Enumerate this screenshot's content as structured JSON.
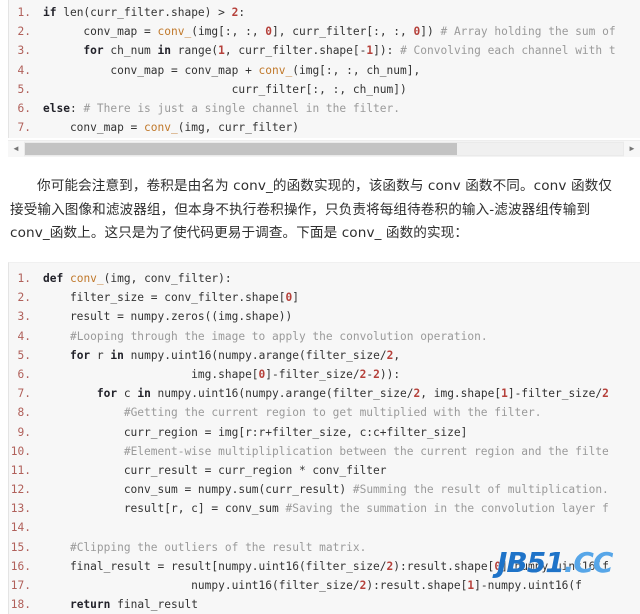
{
  "code_block_one": {
    "language": "python",
    "lines": [
      {
        "num": "1.",
        "tokens": [
          {
            "t": "if",
            "c": "kw"
          },
          {
            "t": " len(curr_filter.shape) > ",
            "c": "pl"
          },
          {
            "t": "2",
            "c": "num"
          },
          {
            "t": ":",
            "c": "pl"
          }
        ]
      },
      {
        "num": "2.",
        "tokens": [
          {
            "t": "      conv_map = ",
            "c": "pl"
          },
          {
            "t": "conv_",
            "c": "fn"
          },
          {
            "t": "(img[:, :, ",
            "c": "pl"
          },
          {
            "t": "0",
            "c": "num"
          },
          {
            "t": "], curr_filter[:, :, ",
            "c": "pl"
          },
          {
            "t": "0",
            "c": "num"
          },
          {
            "t": "]) ",
            "c": "pl"
          },
          {
            "t": "# Array holding the sum of",
            "c": "cm"
          }
        ]
      },
      {
        "num": "3.",
        "tokens": [
          {
            "t": "      ",
            "c": "pl"
          },
          {
            "t": "for",
            "c": "kw"
          },
          {
            "t": " ch_num ",
            "c": "pl"
          },
          {
            "t": "in",
            "c": "kw"
          },
          {
            "t": " range(",
            "c": "pl"
          },
          {
            "t": "1",
            "c": "num"
          },
          {
            "t": ", curr_filter.shape[-",
            "c": "pl"
          },
          {
            "t": "1",
            "c": "num"
          },
          {
            "t": "]): ",
            "c": "pl"
          },
          {
            "t": "# Convolving each channel with t",
            "c": "cm"
          }
        ]
      },
      {
        "num": "4.",
        "tokens": [
          {
            "t": "          conv_map = conv_map + ",
            "c": "pl"
          },
          {
            "t": "conv_",
            "c": "fn"
          },
          {
            "t": "(img[:, :, ch_num],",
            "c": "pl"
          }
        ]
      },
      {
        "num": "5.",
        "tokens": [
          {
            "t": "                            curr_filter[:, :, ch_num])",
            "c": "pl"
          }
        ]
      },
      {
        "num": "6.",
        "tokens": [
          {
            "t": "else",
            "c": "kw"
          },
          {
            "t": ": ",
            "c": "pl"
          },
          {
            "t": "# There is just a single channel in the filter.",
            "c": "cm"
          }
        ]
      },
      {
        "num": "7.",
        "tokens": [
          {
            "t": "    conv_map = ",
            "c": "pl"
          },
          {
            "t": "conv_",
            "c": "fn"
          },
          {
            "t": "(img, curr_filter)",
            "c": "pl"
          }
        ]
      }
    ]
  },
  "scrollbar": {
    "left_arrow": "◄",
    "right_arrow": "►",
    "orientation": "horizontal"
  },
  "paragraph": {
    "line1": "你可能会注意到，卷积是由名为 conv_的函数实现的，该函数与 conv 函数不同。conv 函数仅",
    "line2": "接受输入图像和滤波器组，但本身不执行卷积操作，只负责将每组待卷积的输入-滤波器组传输到",
    "line3": "conv_函数上。这只是为了使代码更易于调查。下面是 conv_ 函数的实现："
  },
  "code_block_two": {
    "language": "python",
    "lines": [
      {
        "num": "1.",
        "tokens": [
          {
            "t": "def",
            "c": "kw"
          },
          {
            "t": " ",
            "c": "pl"
          },
          {
            "t": "conv_",
            "c": "fn"
          },
          {
            "t": "(img, conv_filter):",
            "c": "pl"
          }
        ]
      },
      {
        "num": "2.",
        "tokens": [
          {
            "t": "    filter_size = conv_filter.shape[",
            "c": "pl"
          },
          {
            "t": "0",
            "c": "num"
          },
          {
            "t": "]",
            "c": "pl"
          }
        ]
      },
      {
        "num": "3.",
        "tokens": [
          {
            "t": "    result = numpy.zeros((img.shape))",
            "c": "pl"
          }
        ]
      },
      {
        "num": "4.",
        "tokens": [
          {
            "t": "    ",
            "c": "pl"
          },
          {
            "t": "#Looping through the image to apply the convolution operation.",
            "c": "cm"
          }
        ]
      },
      {
        "num": "5.",
        "tokens": [
          {
            "t": "    ",
            "c": "pl"
          },
          {
            "t": "for",
            "c": "kw"
          },
          {
            "t": " r ",
            "c": "pl"
          },
          {
            "t": "in",
            "c": "kw"
          },
          {
            "t": " numpy.uint16(numpy.arange(filter_size/",
            "c": "pl"
          },
          {
            "t": "2",
            "c": "num"
          },
          {
            "t": ",",
            "c": "pl"
          }
        ]
      },
      {
        "num": "6.",
        "tokens": [
          {
            "t": "                      img.shape[",
            "c": "pl"
          },
          {
            "t": "0",
            "c": "num"
          },
          {
            "t": "]-filter_size/",
            "c": "pl"
          },
          {
            "t": "2",
            "c": "num"
          },
          {
            "t": "-",
            "c": "pl"
          },
          {
            "t": "2",
            "c": "num"
          },
          {
            "t": ")):",
            "c": "pl"
          }
        ]
      },
      {
        "num": "7.",
        "tokens": [
          {
            "t": "        ",
            "c": "pl"
          },
          {
            "t": "for",
            "c": "kw"
          },
          {
            "t": " c ",
            "c": "pl"
          },
          {
            "t": "in",
            "c": "kw"
          },
          {
            "t": " numpy.uint16(numpy.arange(filter_size/",
            "c": "pl"
          },
          {
            "t": "2",
            "c": "num"
          },
          {
            "t": ", img.shape[",
            "c": "pl"
          },
          {
            "t": "1",
            "c": "num"
          },
          {
            "t": "]-filter_size/",
            "c": "pl"
          },
          {
            "t": "2",
            "c": "num"
          }
        ]
      },
      {
        "num": "8.",
        "tokens": [
          {
            "t": "            ",
            "c": "pl"
          },
          {
            "t": "#Getting the current region to get multiplied with the filter.",
            "c": "cm"
          }
        ]
      },
      {
        "num": "9.",
        "tokens": [
          {
            "t": "            curr_region = img[r:r+filter_size, c:c+filter_size]",
            "c": "pl"
          }
        ]
      },
      {
        "num": "10.",
        "tokens": [
          {
            "t": "            ",
            "c": "pl"
          },
          {
            "t": "#Element-wise multipliplication between the current region and the filte",
            "c": "cm"
          }
        ]
      },
      {
        "num": "11.",
        "tokens": [
          {
            "t": "            curr_result = curr_region * conv_filter",
            "c": "pl"
          }
        ]
      },
      {
        "num": "12.",
        "tokens": [
          {
            "t": "            conv_sum = numpy.sum(curr_result) ",
            "c": "pl"
          },
          {
            "t": "#Summing the result of multiplication.",
            "c": "cm"
          }
        ]
      },
      {
        "num": "13.",
        "tokens": [
          {
            "t": "            result[r, c] = conv_sum ",
            "c": "pl"
          },
          {
            "t": "#Saving the summation in the convolution layer f",
            "c": "cm"
          }
        ]
      },
      {
        "num": "14.",
        "tokens": [
          {
            "t": "",
            "c": "pl"
          }
        ]
      },
      {
        "num": "15.",
        "tokens": [
          {
            "t": "    ",
            "c": "pl"
          },
          {
            "t": "#Clipping the outliers of the result matrix.",
            "c": "cm"
          }
        ]
      },
      {
        "num": "16.",
        "tokens": [
          {
            "t": "    final_result = result[numpy.uint16(filter_size/",
            "c": "pl"
          },
          {
            "t": "2",
            "c": "num"
          },
          {
            "t": "):result.shape[",
            "c": "pl"
          },
          {
            "t": "0",
            "c": "num"
          },
          {
            "t": "]-numpy.uint16(f",
            "c": "pl"
          }
        ]
      },
      {
        "num": "17.",
        "tokens": [
          {
            "t": "                      numpy.uint16(filter_size/",
            "c": "pl"
          },
          {
            "t": "2",
            "c": "num"
          },
          {
            "t": "):result.shape[",
            "c": "pl"
          },
          {
            "t": "1",
            "c": "num"
          },
          {
            "t": "]-numpy.uint16(f",
            "c": "pl"
          }
        ]
      },
      {
        "num": "18.",
        "tokens": [
          {
            "t": "    ",
            "c": "pl"
          },
          {
            "t": "return",
            "c": "kw"
          },
          {
            "t": " final_result",
            "c": "pl"
          }
        ]
      }
    ]
  },
  "watermark": {
    "text_primary": "JB51",
    "text_secondary": ".CC",
    "color": "#1e73c8"
  }
}
